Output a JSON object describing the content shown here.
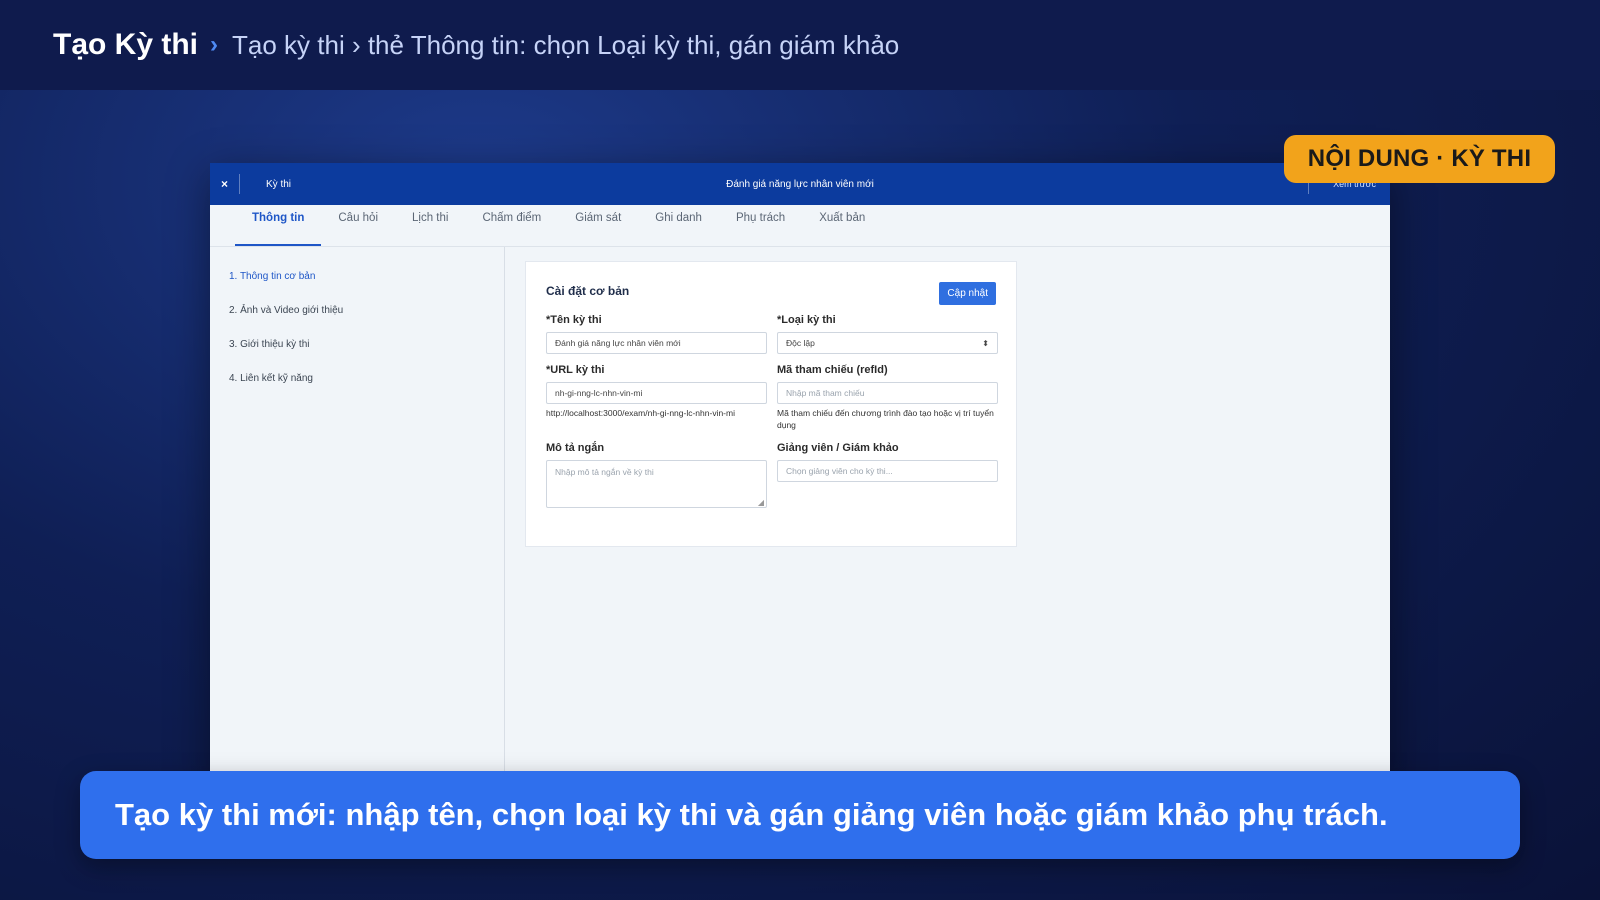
{
  "banner": {
    "title": "Tạo Kỳ thi",
    "separator": "›",
    "crumb": "Tạo kỳ thi › thẻ Thông tin: chọn Loại kỳ thi, gán giám khảo"
  },
  "badge": "NỘI DUNG · KỲ THI",
  "app": {
    "close_icon": "×",
    "crumb": "Kỳ thi",
    "exam_title": "Đánh giá năng lực nhân viên mới",
    "preview_label": "Xem trước",
    "tabs": [
      "Thông tin",
      "Câu hỏi",
      "Lịch thi",
      "Chấm điểm",
      "Giám sát",
      "Ghi danh",
      "Phụ trách",
      "Xuất bản"
    ],
    "sidebar": [
      "1. Thông tin cơ bản",
      "2. Ảnh và Video giới thiệu",
      "3. Giới thiệu kỳ thi",
      "4. Liên kết kỹ năng"
    ],
    "card": {
      "title": "Cài đặt cơ bản",
      "update_button": "Cập nhật",
      "name_label": "*Tên kỳ thi",
      "name_value": "Đánh giá năng lực nhân viên mới",
      "type_label": "*Loại kỳ thi",
      "type_value": "Độc lập",
      "url_label": "*URL kỳ thi",
      "url_value": "nh-gi-nng-lc-nhn-vin-mi",
      "url_hint": "http://localhost:3000/exam/nh-gi-nng-lc-nhn-vin-mi",
      "ref_label": "Mã tham chiếu (refId)",
      "ref_placeholder": "Nhập mã tham chiếu",
      "ref_hint": "Mã tham chiếu đến chương trình đào tạo hoặc vị trí tuyển dụng",
      "desc_label": "Mô tả ngắn",
      "desc_placeholder": "Nhập mô tả ngắn về kỳ thi",
      "examiner_label": "Giảng viên / Giám khảo",
      "examiner_placeholder": "Chọn giảng viên cho kỳ thi..."
    }
  },
  "caption": "Tạo kỳ thi mới: nhập tên, chọn loại kỳ thi và gán giảng viên hoặc giám khảo phụ trách.",
  "colors": {
    "banner_bg": "#0f1b4d",
    "app_header": "#0c3b9e",
    "accent": "#1e56c7",
    "badge": "#f2a31b",
    "caption_bg": "#2f6fed"
  }
}
